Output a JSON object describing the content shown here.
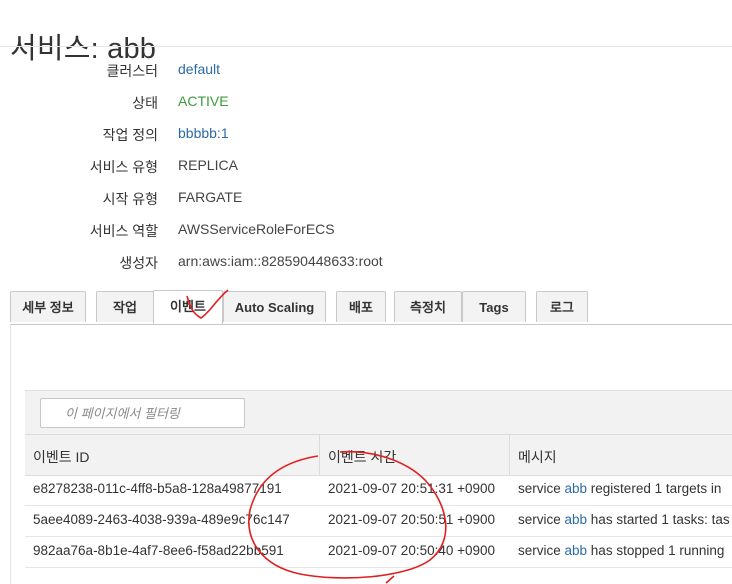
{
  "page": {
    "title": "서비스: abb"
  },
  "details": [
    {
      "label": "클러스터",
      "value": "default",
      "style": "link"
    },
    {
      "label": "상태",
      "value": "ACTIVE",
      "style": "active"
    },
    {
      "label": "작업 정의",
      "value": "bbbbb:1",
      "style": "link"
    },
    {
      "label": "서비스 유형",
      "value": "REPLICA",
      "style": "plain"
    },
    {
      "label": "시작 유형",
      "value": "FARGATE",
      "style": "plain"
    },
    {
      "label": "서비스 역할",
      "value": "AWSServiceRoleForECS",
      "style": "plain"
    },
    {
      "label": "생성자",
      "value": "arn:aws:iam::828590448633:root",
      "style": "plain"
    }
  ],
  "tabs": [
    {
      "label": "세부 정보",
      "active": false
    },
    {
      "label": "작업",
      "active": false
    },
    {
      "label": "이벤트",
      "active": true
    },
    {
      "label": "Auto Scaling",
      "active": false
    },
    {
      "label": "배포",
      "active": false
    },
    {
      "label": "측정치",
      "active": false
    },
    {
      "label": "Tags",
      "active": false
    },
    {
      "label": "로그",
      "active": false
    }
  ],
  "filter": {
    "placeholder": "이 페이지에서 필터링",
    "icon": "filter-icon"
  },
  "table": {
    "columns": [
      "이벤트 ID",
      "이벤트 시간",
      "메시지"
    ],
    "rows": [
      {
        "id": "e8278238-011c-4ff8-b5a8-128a49877191",
        "time": "2021-09-07 20:51:31 +0900",
        "msg_pre": "service ",
        "msg_link": "abb",
        "msg_post": " registered 1 targets in"
      },
      {
        "id": "5aee4089-2463-4038-939a-489e9c76c147",
        "time": "2021-09-07 20:50:51 +0900",
        "msg_pre": "service ",
        "msg_link": "abb",
        "msg_post": " has started 1 tasks: tas"
      },
      {
        "id": "982aa76a-8b1e-4af7-8ee6-f58ad22bb591",
        "time": "2021-09-07 20:50:40 +0900",
        "msg_pre": "service ",
        "msg_link": "abb",
        "msg_post": " has stopped 1 running"
      }
    ]
  },
  "colors": {
    "link": "#2d6ba8",
    "active": "#3c9b3c",
    "annotation": "#e02020"
  }
}
